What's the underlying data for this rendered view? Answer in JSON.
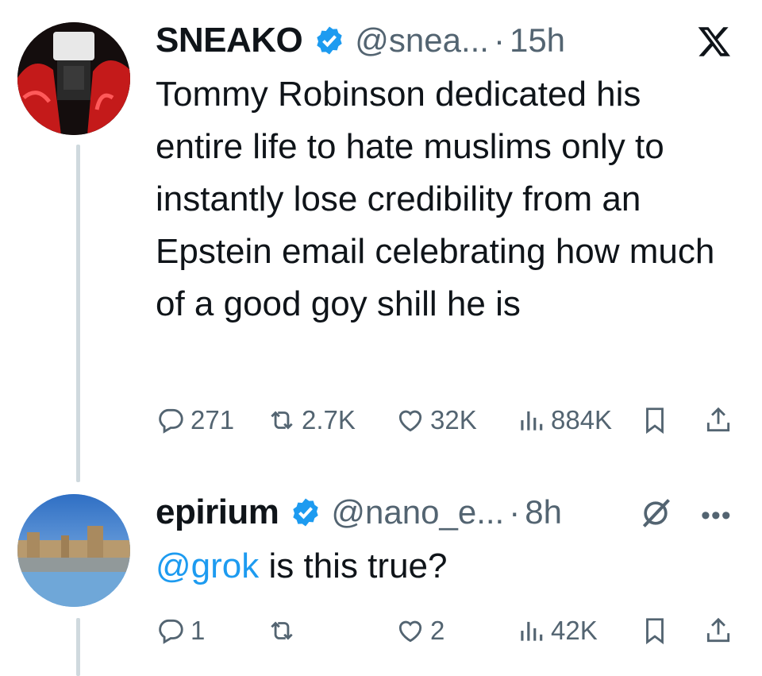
{
  "tweets": [
    {
      "author": "SNEAKO",
      "handle": "@snea...",
      "time": "15h",
      "text": "Tommy Robinson dedicated his entire life to hate muslims only to instantly lose credibility from an Epstein email celebrating how much of a good goy shill he is",
      "replies": "271",
      "reposts": "2.7K",
      "likes": "32K",
      "views": "884K"
    },
    {
      "author": "epirium",
      "handle": "@nano_e...",
      "time": "8h",
      "mention": "@grok",
      "text_after_mention": " is this true?",
      "replies": "1",
      "reposts": "",
      "likes": "2",
      "views": "42K"
    }
  ],
  "separator": "·",
  "more_label": "•••",
  "colors": {
    "accent": "#1d9bf0",
    "muted": "#536471",
    "text": "#0f1419",
    "thread_line": "#cfd9de"
  },
  "icons": [
    "verified-badge-icon",
    "x-logo-icon",
    "reply-icon",
    "repost-icon",
    "like-icon",
    "views-icon",
    "bookmark-icon",
    "share-icon",
    "grok-icon",
    "more-icon"
  ]
}
